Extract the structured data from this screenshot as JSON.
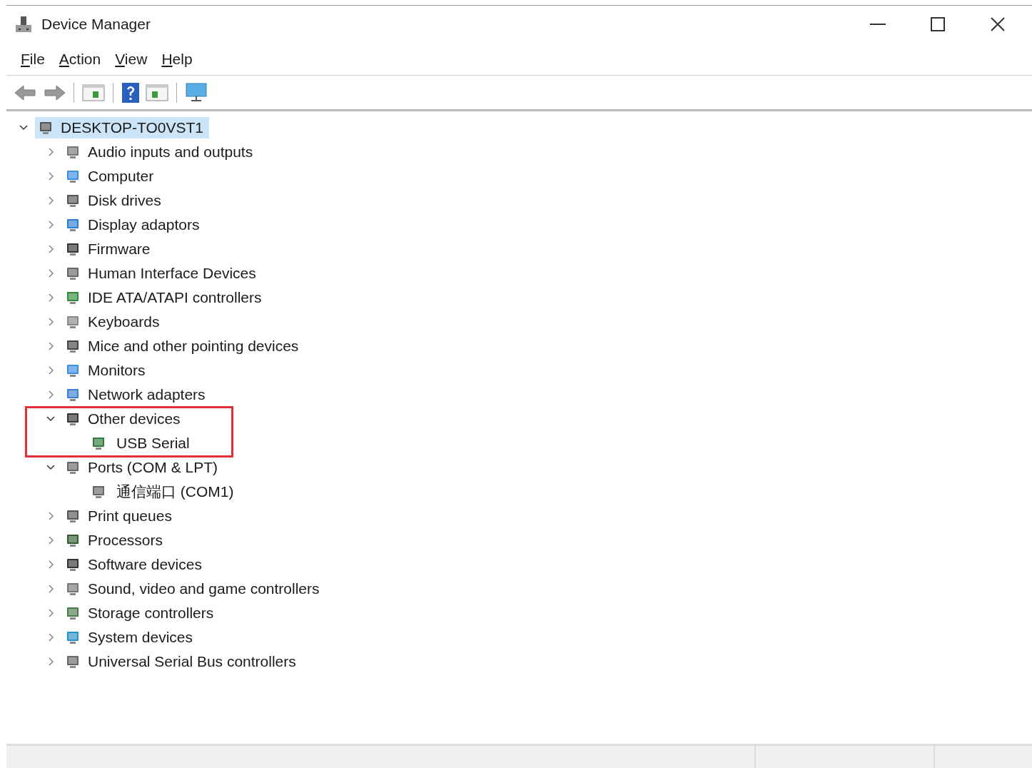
{
  "window": {
    "title": "Device Manager"
  },
  "menu": [
    "File",
    "Action",
    "View",
    "Help"
  ],
  "tree": {
    "label": "DESKTOP-TO0VST1",
    "expanded": true,
    "selected": true,
    "children": [
      {
        "label": "Audio inputs and outputs",
        "expanded": false
      },
      {
        "label": "Computer",
        "expanded": false
      },
      {
        "label": "Disk drives",
        "expanded": false
      },
      {
        "label": "Display adaptors",
        "expanded": false
      },
      {
        "label": "Firmware",
        "expanded": false
      },
      {
        "label": "Human Interface Devices",
        "expanded": false
      },
      {
        "label": "IDE ATA/ATAPI controllers",
        "expanded": false
      },
      {
        "label": "Keyboards",
        "expanded": false
      },
      {
        "label": "Mice and other pointing devices",
        "expanded": false
      },
      {
        "label": "Monitors",
        "expanded": false
      },
      {
        "label": "Network adapters",
        "expanded": false
      },
      {
        "label": "Other devices",
        "expanded": true,
        "highlighted": true,
        "children": [
          {
            "label": "USB Serial"
          }
        ]
      },
      {
        "label": "Ports (COM & LPT)",
        "expanded": true,
        "children": [
          {
            "label": "通信端口 (COM1)"
          }
        ]
      },
      {
        "label": "Print queues",
        "expanded": false
      },
      {
        "label": "Processors",
        "expanded": false
      },
      {
        "label": "Software devices",
        "expanded": false
      },
      {
        "label": "Sound, video and game controllers",
        "expanded": false
      },
      {
        "label": "Storage controllers",
        "expanded": false
      },
      {
        "label": "System devices",
        "expanded": false
      },
      {
        "label": "Universal Serial Bus controllers",
        "expanded": false
      }
    ]
  }
}
